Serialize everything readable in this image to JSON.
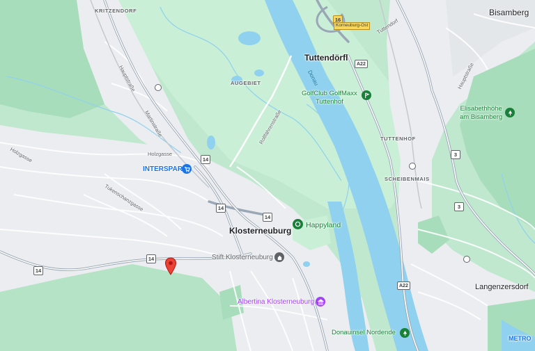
{
  "labels": {
    "kritzendorf": "KRITZENDORF",
    "bisamberg": "Bisamberg",
    "tuttendorfl": "Tuttendörfl",
    "augebiet": "AUGEBIET",
    "donau": "Donau",
    "golfclub": "GolfClub GolfMaxx\nTuttenhof",
    "tuttenhof": "TUTTENHOF",
    "elisabethhohe": "Elisabethhöhe\nam Bisamberg",
    "interspar": "INTERSPAR",
    "holzgasse": "Holzgasse",
    "holzgasse2": "Holzgasse",
    "scheibenmais": "SCHEIBENMAIS",
    "tukenschanzgasse": "Tukenschanzgasse",
    "klosterneuburg": "Klosterneuburg",
    "happyland": "Happyland",
    "stift": "Stift Klosterneuburg",
    "albertina": "Albertina Klosterneuburg",
    "langenzersdorf": "Langenzersdorf",
    "donauinsel": "Donauinsel Nordende",
    "metro": "METRO",
    "hauptstrasse": "Hauptstraße",
    "hauptstrasse2": "Hauptstraße",
    "martinstrasse": "Martinstraße",
    "rollfahrstrasse": "Rollfährenstraße",
    "tuttendorf_st": "Tuttendorf",
    "korneuburg_ost": "Korneuburg-Ost"
  },
  "road_numbers": {
    "r16": "16",
    "r14a": "14",
    "r14b": "14",
    "r14c": "14",
    "r14d": "14",
    "r14e": "14",
    "r3a": "3",
    "r3b": "3",
    "a22a": "A22",
    "a22b": "A22"
  },
  "icons": {
    "marker": "location-pin-icon",
    "shopping": "shopping-cart-icon",
    "golf": "golf-icon",
    "park": "park-icon",
    "church": "church-icon",
    "museum": "museum-icon",
    "nature": "nature-icon",
    "transit": "train-station-icon"
  },
  "colors": {
    "water": "#8fd1ee",
    "park": "#a8e6c0",
    "urban": "#ebedf0",
    "road": "#ffffff",
    "major_road": "#b7c3d0",
    "marker": "#ea4335"
  }
}
